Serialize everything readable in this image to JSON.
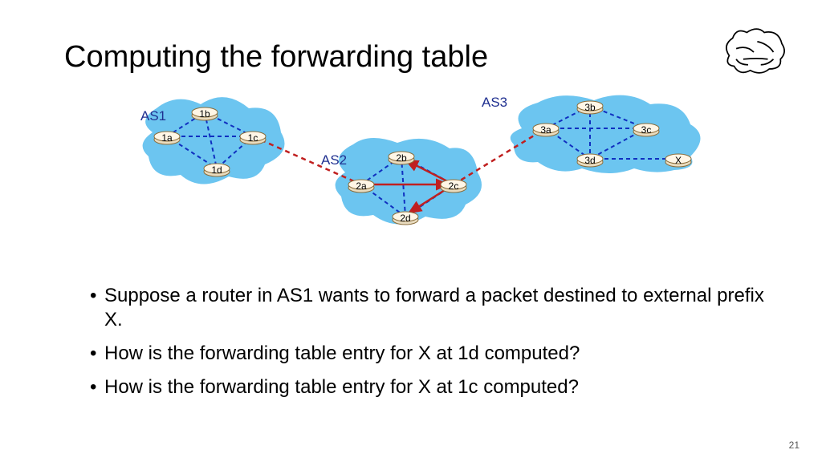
{
  "title": "Computing the forwarding table",
  "as_labels": {
    "as1": "AS1",
    "as2": "AS2",
    "as3": "AS3"
  },
  "routers": {
    "r1a": "1a",
    "r1b": "1b",
    "r1c": "1c",
    "r1d": "1d",
    "r2a": "2a",
    "r2b": "2b",
    "r2c": "2c",
    "r2d": "2d",
    "r3a": "3a",
    "r3b": "3b",
    "r3c": "3c",
    "r3d": "3d",
    "rx": "X"
  },
  "bullets": [
    "Suppose a router in AS1 wants to forward a packet destined to external prefix X.",
    "How is the forwarding table entry for X at 1d computed?",
    "How is the forwarding table entry for X at 1c computed?"
  ],
  "page": "21"
}
